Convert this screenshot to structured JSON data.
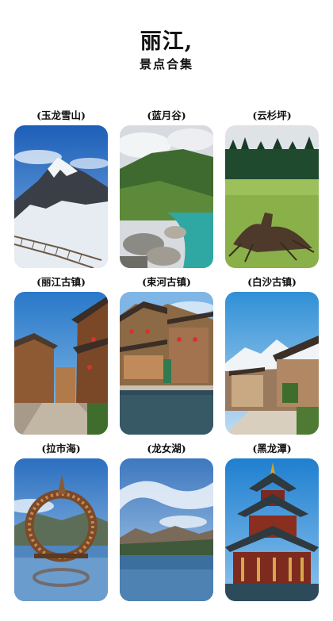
{
  "header": {
    "title": "丽江,",
    "subtitle": "景点合集"
  },
  "spots": [
    {
      "label": "(玉龙雪山)",
      "scene": "snow-mountain"
    },
    {
      "label": "(蓝月谷)",
      "scene": "valley-river"
    },
    {
      "label": "(云杉坪)",
      "scene": "meadow-forest"
    },
    {
      "label": "(丽江古镇)",
      "scene": "old-town"
    },
    {
      "label": "(束河古镇)",
      "scene": "river-town"
    },
    {
      "label": "(白沙古镇)",
      "scene": "baisha-town"
    },
    {
      "label": "(拉市海)",
      "scene": "lake-wreath"
    },
    {
      "label": "(龙女湖)",
      "scene": "blue-lake"
    },
    {
      "label": "(黑龙潭)",
      "scene": "pavilion"
    }
  ]
}
